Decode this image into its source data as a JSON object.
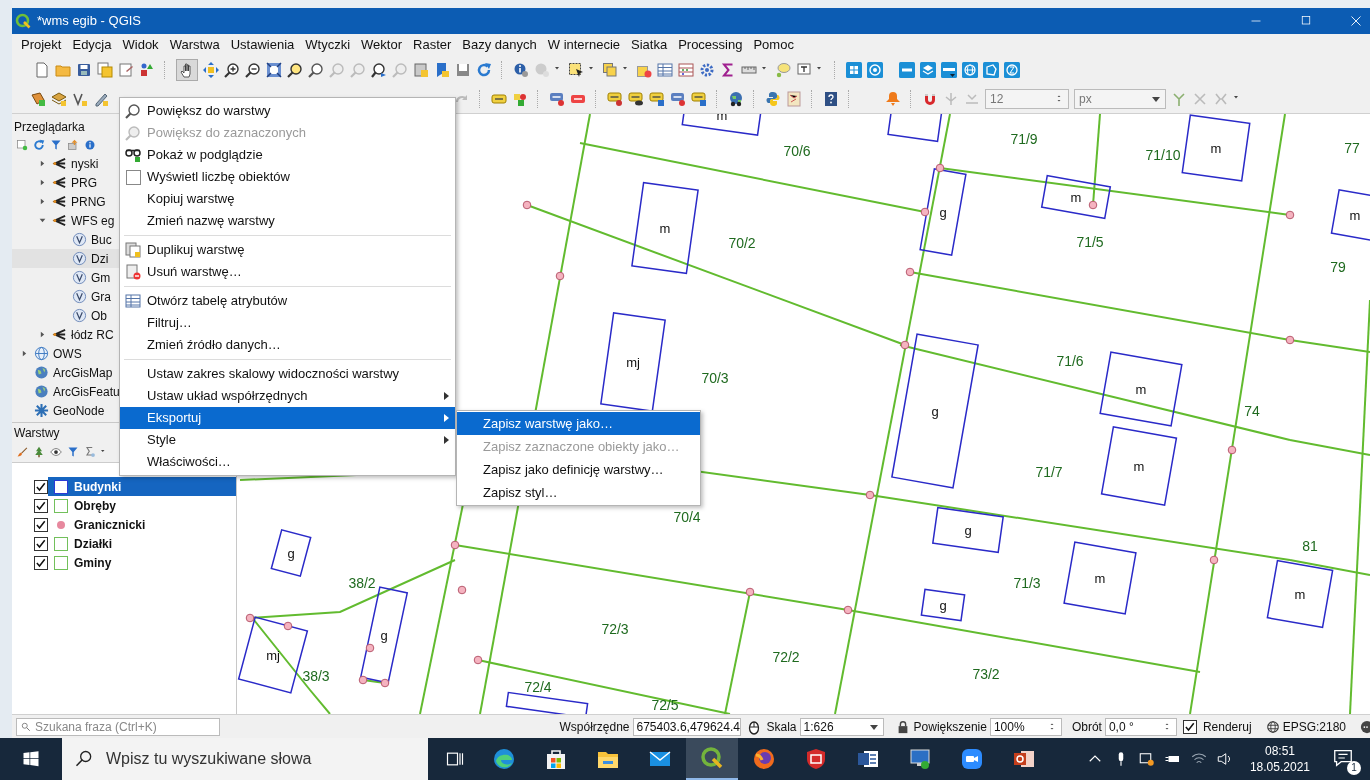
{
  "window": {
    "title": "*wms egib - QGIS"
  },
  "menu_bar": [
    "Projekt",
    "Edycja",
    "Widok",
    "Warstwa",
    "Ustawienia",
    "Wtyczki",
    "Wektor",
    "Raster",
    "Bazy danych",
    "W internecie",
    "Siatka",
    "Processing",
    "Pomoc"
  ],
  "toolbar": {
    "size_value": "12",
    "unit_value": "px"
  },
  "browser_panel": {
    "title": "Przeglądarka",
    "items": [
      {
        "label": "nyski",
        "kind": "connection",
        "expanded": false,
        "selected": false
      },
      {
        "label": "PRG",
        "kind": "connection",
        "expanded": false,
        "selected": false
      },
      {
        "label": "PRNG",
        "kind": "connection",
        "expanded": false,
        "selected": false
      },
      {
        "label": "WFS eg",
        "kind": "connection",
        "expanded": true,
        "selected": false,
        "children": [
          {
            "label": "Buc",
            "kind": "vector",
            "selected": false
          },
          {
            "label": "Dzi",
            "kind": "vector",
            "selected": true
          },
          {
            "label": "Gm",
            "kind": "vector",
            "selected": false
          },
          {
            "label": "Gra",
            "kind": "vector",
            "selected": false
          },
          {
            "label": "Ob",
            "kind": "vector",
            "selected": false
          }
        ]
      },
      {
        "label": "łódz RC",
        "kind": "connection",
        "expanded": false,
        "selected": false
      },
      {
        "label": "OWS",
        "kind": "ows",
        "expanded": false,
        "selected": false
      },
      {
        "label": "ArcGisMap",
        "kind": "arcgis",
        "selected": false
      },
      {
        "label": "ArcGisFeatu",
        "kind": "arcgis",
        "selected": false
      },
      {
        "label": "GeoNode",
        "kind": "geonode",
        "selected": false
      }
    ]
  },
  "layers_panel": {
    "title": "Warstwy",
    "layers": [
      {
        "name": "Budynki",
        "checked": true,
        "selected": true,
        "kind": "fill",
        "color": "#2b3bd6"
      },
      {
        "name": "Obręby",
        "checked": true,
        "selected": false,
        "kind": "fill",
        "color": "#72c05b"
      },
      {
        "name": "Granicznicki",
        "checked": true,
        "selected": false,
        "kind": "point",
        "color": "#e7889e"
      },
      {
        "name": "Działki",
        "checked": true,
        "selected": false,
        "kind": "fill",
        "color": "#72c05b"
      },
      {
        "name": "Gminy",
        "checked": true,
        "selected": false,
        "kind": "fill",
        "color": "#72c05b"
      }
    ]
  },
  "context_menu": {
    "items": [
      {
        "kind": "action",
        "label": "Powiększ do warstwy",
        "disabled": false,
        "selected": false,
        "submenu": false
      },
      {
        "kind": "action",
        "label": "Powiększ do zaznaczonych",
        "disabled": true,
        "selected": false,
        "submenu": false
      },
      {
        "kind": "action",
        "label": "Pokaż w podglądzie",
        "disabled": false,
        "selected": false,
        "submenu": false
      },
      {
        "kind": "checkbox",
        "label": "Wyświetl liczbę obiektów",
        "checked": false,
        "disabled": false,
        "selected": false,
        "submenu": false
      },
      {
        "kind": "action",
        "label": "Kopiuj warstwę",
        "disabled": false,
        "selected": false,
        "submenu": false
      },
      {
        "kind": "action",
        "label": "Zmień nazwę warstwy",
        "disabled": false,
        "selected": false,
        "submenu": false
      },
      {
        "kind": "separator"
      },
      {
        "kind": "action",
        "label": "Duplikuj warstwę",
        "disabled": false,
        "selected": false,
        "submenu": false
      },
      {
        "kind": "action",
        "label": "Usuń warstwę…",
        "disabled": false,
        "selected": false,
        "submenu": false
      },
      {
        "kind": "separator"
      },
      {
        "kind": "action",
        "label": "Otwórz tabelę atrybutów",
        "disabled": false,
        "selected": false,
        "submenu": false
      },
      {
        "kind": "action",
        "label": "Filtruj…",
        "disabled": false,
        "selected": false,
        "submenu": false
      },
      {
        "kind": "action",
        "label": "Zmień źródło danych…",
        "disabled": false,
        "selected": false,
        "submenu": false
      },
      {
        "kind": "separator"
      },
      {
        "kind": "action",
        "label": "Ustaw zakres skalowy widoczności warstwy",
        "disabled": false,
        "selected": false,
        "submenu": false
      },
      {
        "kind": "action",
        "label": "Ustaw układ współrzędnych",
        "disabled": false,
        "selected": false,
        "submenu": true
      },
      {
        "kind": "action",
        "label": "Eksportuj",
        "disabled": false,
        "selected": true,
        "submenu": true
      },
      {
        "kind": "action",
        "label": "Style",
        "disabled": false,
        "selected": false,
        "submenu": true
      },
      {
        "kind": "action",
        "label": "Właściwości…",
        "disabled": false,
        "selected": false,
        "submenu": false
      }
    ]
  },
  "submenu": {
    "items": [
      {
        "label": "Zapisz warstwę jako…",
        "disabled": false,
        "selected": true
      },
      {
        "label": "Zapisz zaznaczone obiekty jako…",
        "disabled": true,
        "selected": false
      },
      {
        "label": "Zapisz jako definicję warstwy…",
        "disabled": false,
        "selected": false
      },
      {
        "label": "Zapisz styl…",
        "disabled": false,
        "selected": false
      }
    ]
  },
  "map": {
    "parcels": [
      "70/6",
      "71/9",
      "71/10",
      "77",
      "70/2",
      "71/5",
      "79",
      "70/3",
      "71/6",
      "74",
      "71/7",
      "70/4",
      "81",
      "71/3",
      "38/2",
      "72/3",
      "72/2",
      "38/3",
      "73/2",
      "72/4",
      "72/5"
    ],
    "buildings": [
      "m",
      "m",
      "m",
      "m",
      "g",
      "m",
      "mj",
      "g",
      "m",
      "m",
      "g",
      "m",
      "g",
      "m",
      "g",
      "g",
      "mj"
    ]
  },
  "status_bar": {
    "search_placeholder": "Szukana fraza (Ctrl+K)",
    "coord_label": "Współrzędne",
    "coord_value": "675403.6,479624.4",
    "scale_label": "Skala",
    "scale_value": "1:626",
    "magnifier_label": "Powiększenie",
    "magnifier_value": "100%",
    "rotation_label": "Obrót",
    "rotation_value": "0,0 °",
    "render": {
      "label": "Renderuj",
      "checked": true
    },
    "crs": "EPSG:2180"
  },
  "taskbar": {
    "search_placeholder": "Wpisz tu wyszukiwane słowa",
    "apps": [
      {
        "selected": false
      },
      {
        "selected": false
      },
      {
        "selected": false
      },
      {
        "selected": false
      },
      {
        "selected": true
      },
      {
        "selected": false
      },
      {
        "selected": false
      },
      {
        "selected": false
      },
      {
        "selected": false
      },
      {
        "selected": false
      },
      {
        "selected": false
      }
    ],
    "time": "08:51",
    "date": "18.05.2021",
    "notification_count": "1"
  }
}
